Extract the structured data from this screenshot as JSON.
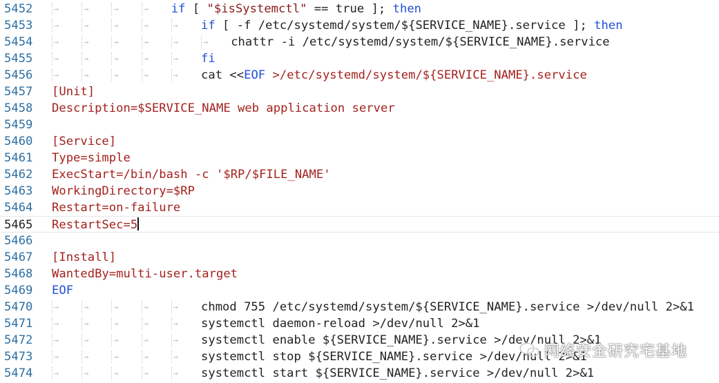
{
  "lines": [
    {
      "num": "5452",
      "indent": 4,
      "segments": [
        {
          "t": "if",
          "c": "kw"
        },
        {
          "t": " [ ",
          "c": "blk"
        },
        {
          "t": "\"$isSystemctl\"",
          "c": "str"
        },
        {
          "t": " == ",
          "c": "blk"
        },
        {
          "t": "true",
          "c": "blk"
        },
        {
          "t": " ]; ",
          "c": "blk"
        },
        {
          "t": "then",
          "c": "kw"
        }
      ]
    },
    {
      "num": "5453",
      "indent": 5,
      "segments": [
        {
          "t": "if",
          "c": "kw"
        },
        {
          "t": " [ ",
          "c": "blk"
        },
        {
          "t": "-f /etc/systemd/system/${SERVICE_NAME}.service",
          "c": "blk"
        },
        {
          "t": " ]; ",
          "c": "blk"
        },
        {
          "t": "then",
          "c": "kw"
        }
      ]
    },
    {
      "num": "5454",
      "indent": 6,
      "segments": [
        {
          "t": "chattr -i /etc/systemd/system/${SERVICE_NAME}.service",
          "c": "blk"
        }
      ]
    },
    {
      "num": "5455",
      "indent": 5,
      "segments": [
        {
          "t": "fi",
          "c": "kw"
        }
      ]
    },
    {
      "num": "5456",
      "indent": 5,
      "segments": [
        {
          "t": "cat ",
          "c": "blk"
        },
        {
          "t": "<<",
          "c": "blk"
        },
        {
          "t": "EOF",
          "c": "kw"
        },
        {
          "t": " >/etc/systemd/system/${SERVICE_NAME}.service",
          "c": "red"
        }
      ]
    },
    {
      "num": "5457",
      "indent": 0,
      "segments": [
        {
          "t": "[Unit]",
          "c": "red"
        }
      ]
    },
    {
      "num": "5458",
      "indent": 0,
      "segments": [
        {
          "t": "Description=$SERVICE_NAME web application server",
          "c": "red"
        }
      ]
    },
    {
      "num": "5459",
      "indent": 0,
      "segments": []
    },
    {
      "num": "5460",
      "indent": 0,
      "segments": [
        {
          "t": "[Service]",
          "c": "red"
        }
      ]
    },
    {
      "num": "5461",
      "indent": 0,
      "segments": [
        {
          "t": "Type=simple",
          "c": "red"
        }
      ]
    },
    {
      "num": "5462",
      "indent": 0,
      "segments": [
        {
          "t": "ExecStart=/bin/bash -c '$RP/$FILE_NAME'",
          "c": "red"
        }
      ]
    },
    {
      "num": "5463",
      "indent": 0,
      "segments": [
        {
          "t": "WorkingDirectory=$RP",
          "c": "red"
        }
      ]
    },
    {
      "num": "5464",
      "indent": 0,
      "segments": [
        {
          "t": "Restart=on-failure",
          "c": "red"
        }
      ]
    },
    {
      "num": "5465",
      "indent": 0,
      "current": true,
      "caret": true,
      "segments": [
        {
          "t": "RestartSec=5",
          "c": "red"
        }
      ]
    },
    {
      "num": "5466",
      "indent": 0,
      "segments": []
    },
    {
      "num": "5467",
      "indent": 0,
      "segments": [
        {
          "t": "[Install]",
          "c": "red"
        }
      ]
    },
    {
      "num": "5468",
      "indent": 0,
      "segments": [
        {
          "t": "WantedBy=multi-user.target",
          "c": "red"
        }
      ]
    },
    {
      "num": "5469",
      "indent": 0,
      "segments": [
        {
          "t": "EOF",
          "c": "kw"
        }
      ]
    },
    {
      "num": "5470",
      "indent": 5,
      "segments": [
        {
          "t": "chmod 755 /etc/systemd/system/${SERVICE_NAME}.service ",
          "c": "blk"
        },
        {
          "t": ">/dev/null 2>&1",
          "c": "blk"
        }
      ]
    },
    {
      "num": "5471",
      "indent": 5,
      "segments": [
        {
          "t": "systemctl daemon-reload ",
          "c": "blk"
        },
        {
          "t": ">/dev/null 2>&1",
          "c": "blk"
        }
      ]
    },
    {
      "num": "5472",
      "indent": 5,
      "segments": [
        {
          "t": "systemctl enable ${SERVICE_NAME}.service ",
          "c": "blk"
        },
        {
          "t": ">/dev/null 2>&1",
          "c": "blk"
        }
      ]
    },
    {
      "num": "5473",
      "indent": 5,
      "segments": [
        {
          "t": "systemctl stop ${SERVICE_NAME}.service ",
          "c": "blk"
        },
        {
          "t": ">/dev/null 2>&1",
          "c": "blk"
        }
      ]
    },
    {
      "num": "5474",
      "indent": 5,
      "segments": [
        {
          "t": "systemctl start ${SERVICE_NAME}.service ",
          "c": "blk"
        },
        {
          "t": ">/dev/null 2>&1",
          "c": "blk"
        }
      ]
    }
  ],
  "watermark": {
    "text": "网络安全研究宅基地",
    "icon": "wechat-icon"
  },
  "colors": {
    "keyword": "#1f4fd6",
    "heredoc": "#a3211e",
    "string": "#8b1a1a",
    "line_number": "#2d6fa3"
  }
}
